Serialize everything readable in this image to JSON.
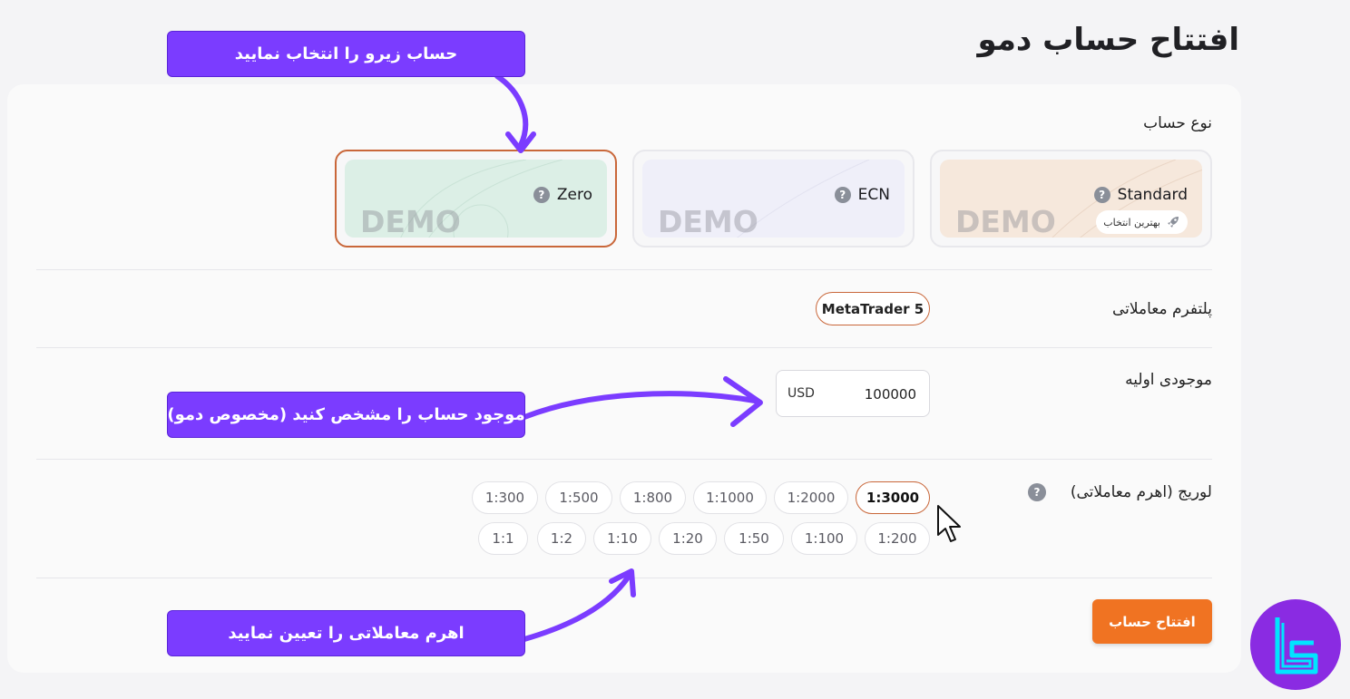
{
  "page": {
    "title": "افتتاح حساب دمو"
  },
  "form": {
    "account_type_label": "نوع حساب",
    "platform_label": "پلتفرم معاملاتی",
    "balance_label": "موجودی اولیه",
    "leverage_label": "لوریج (اهرم معاملاتی)"
  },
  "accounts": [
    {
      "name": "Standard",
      "demo_text": "DEMO",
      "badge": "بهترین انتخاب",
      "bg": "#f6e8dc"
    },
    {
      "name": "ECN",
      "demo_text": "DEMO",
      "bg": "#efeff9"
    },
    {
      "name": "Zero",
      "demo_text": "DEMO",
      "selected": true,
      "bg": "#dcefe6"
    }
  ],
  "platform": {
    "selected": "MetaTrader 5"
  },
  "balance": {
    "currency": "USD",
    "value": "100000"
  },
  "leverage": {
    "row1": [
      "1:3000",
      "1:2000",
      "1:1000",
      "1:800",
      "1:500",
      "1:300"
    ],
    "row2": [
      "1:200",
      "1:100",
      "1:50",
      "1:20",
      "1:10",
      "1:2",
      "1:1"
    ],
    "selected": "1:3000"
  },
  "actions": {
    "open_account": "افتتاح حساب"
  },
  "callouts": {
    "select_zero": "حساب زیرو را انتخاب نمایید",
    "set_balance": "موجود حساب را مشخص کنید (مخصوص دمو)",
    "set_leverage": "اهرم معاملاتی را تعیین نمایید"
  },
  "colors": {
    "accent": "#f07322",
    "selected_border": "#c9673a",
    "callout": "#7b3cff"
  },
  "icons": {
    "help": "help-circle-icon",
    "rocket": "rocket-icon",
    "cursor": "mouse-pointer-icon",
    "logo": "brand-logo-icon"
  }
}
